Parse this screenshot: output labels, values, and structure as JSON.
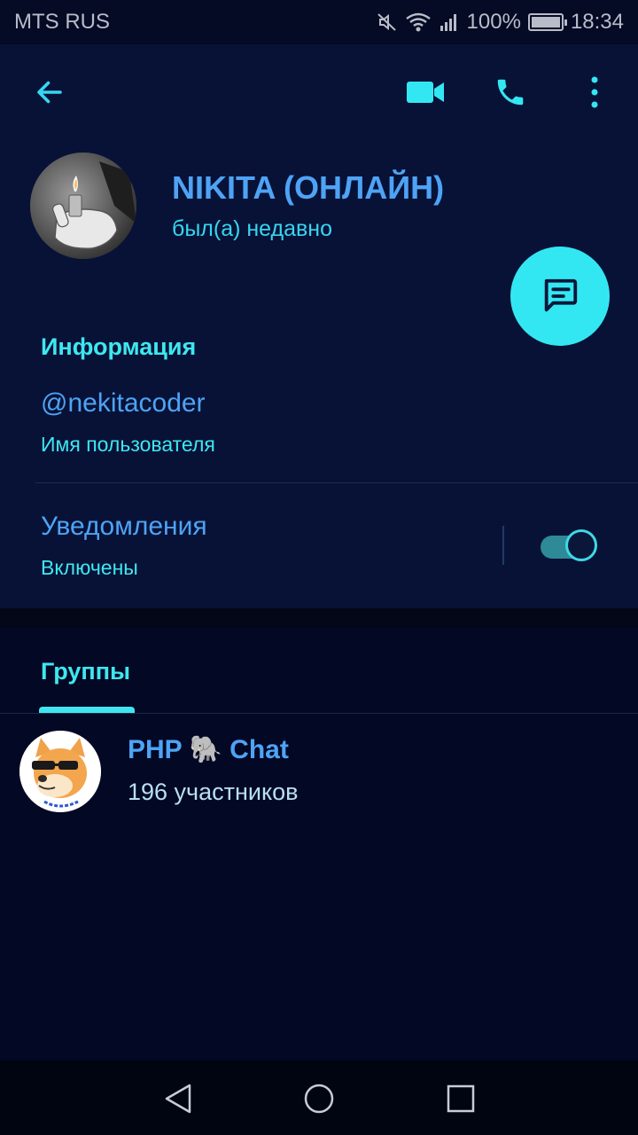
{
  "status_bar": {
    "carrier": "MTS RUS",
    "battery": "100%",
    "time": "18:34",
    "icons": [
      "mute-icon",
      "wifi-icon",
      "signal-icon",
      "battery-charging-icon"
    ]
  },
  "toolbar": {
    "icons": [
      "arrow-back-icon",
      "video-camera-icon",
      "phone-icon",
      "more-vertical-icon"
    ]
  },
  "profile": {
    "name": "NIKITA (ОНЛАЙН)",
    "status": "был(а) недавно"
  },
  "info": {
    "title": "Информация",
    "username": "@nekitacoder",
    "username_label": "Имя пользователя"
  },
  "notifications": {
    "title": "Уведомления",
    "status": "Включены",
    "enabled": true
  },
  "groups": {
    "tab_label": "Группы",
    "items": [
      {
        "name": "PHP 🐘 Chat",
        "members": "196 участников"
      }
    ]
  },
  "navbar": {
    "icons": [
      "nav-back-icon",
      "nav-home-icon",
      "nav-recents-icon"
    ]
  },
  "colors": {
    "background": "#050a25",
    "header": "#081237",
    "accent_cyan": "#33e7f2",
    "accent_blue": "#4ea3f5"
  }
}
